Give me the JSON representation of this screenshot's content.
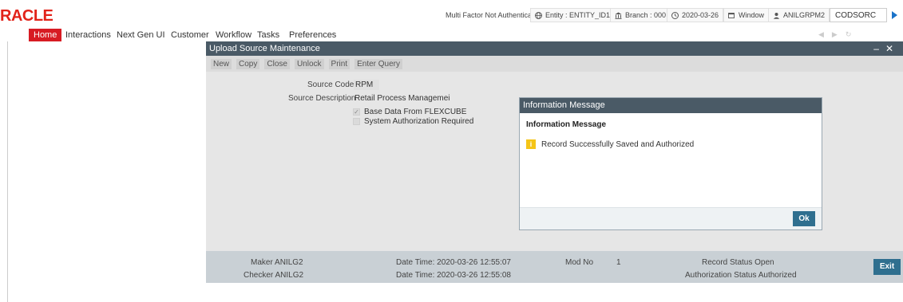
{
  "header": {
    "logo": "RACLE",
    "mfa_status": "Multi Factor Not Authenticated",
    "entity": "Entity : ENTITY_ID1",
    "branch": "Branch : 000",
    "date": "2020-03-26",
    "window": "Window",
    "user": "ANILGRPM2",
    "environment": "CODSORC"
  },
  "menu": {
    "home": "Home",
    "interactions": "Interactions",
    "next_gen_ui": "Next Gen UI",
    "customer": "Customer",
    "workflow": "Workflow",
    "tasks": "Tasks",
    "preferences": "Preferences"
  },
  "window": {
    "title": "Upload Source Maintenance",
    "controls": "- X",
    "toolbar": {
      "new": "New",
      "copy": "Copy",
      "close": "Close",
      "unlock": "Unlock",
      "print": "Print",
      "enter_query": "Enter Query"
    },
    "form": {
      "source_code_label": "Source Code",
      "required_mark": "*",
      "source_code_value": "RPM",
      "source_description_label": "Source Description",
      "source_description_value": "Retail Process Managemei",
      "base_data_label": "Base Data From FLEXCUBE",
      "base_data_checked": true,
      "sys_auth_label": "System Authorization Required",
      "sys_auth_checked": false
    },
    "footer": {
      "maker_label": "Maker",
      "maker": "ANILG2",
      "checker_label": "Checker",
      "checker": "ANILG2",
      "date_time_label": "Date Time:",
      "maker_datetime": "2020-03-26 12:55:07",
      "checker_datetime": "2020-03-26 12:55:08",
      "mod_no_label": "Mod No",
      "mod_no": "1",
      "record_status_label": "Record Status",
      "record_status": "Open",
      "auth_status_label": "Authorization Status",
      "auth_status": "Authorized",
      "exit": "Exit"
    }
  },
  "dialog": {
    "title": "Information Message",
    "heading": "Information Message",
    "message": "Record Successfully Saved and Authorized",
    "ok": "Ok"
  },
  "colors": {
    "accent_red": "#d71b23",
    "title_bar": "#4a5a66",
    "button_blue": "#2f6f8f",
    "info_yellow": "#f5c518"
  }
}
